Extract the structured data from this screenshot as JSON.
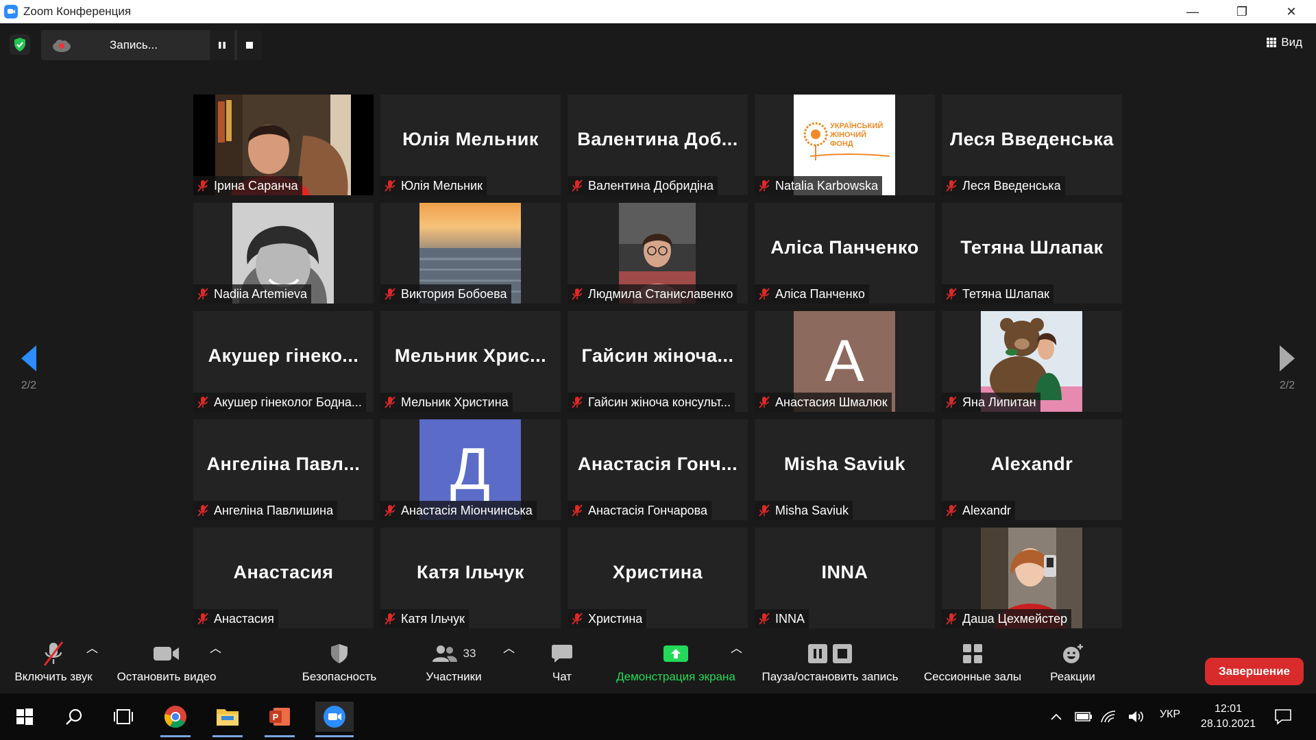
{
  "window": {
    "title": "Zoom Конференция",
    "minimize": "—",
    "restore": "❐",
    "close": "✕"
  },
  "recording": {
    "label": "Запись..."
  },
  "view": {
    "label": "Вид"
  },
  "nav": {
    "left_page": "2/2",
    "right_page": "2/2"
  },
  "participants": [
    {
      "name": "Ірина Саранча",
      "display": "",
      "tile": "photo-woman-red"
    },
    {
      "name": "Юлія Мельник",
      "display": "Юлія Мельник",
      "tile": "name"
    },
    {
      "name": "Валентина Добридіна",
      "display": "Валентина Доб...",
      "tile": "name"
    },
    {
      "name": "Natalia Karbowska",
      "display": "",
      "tile": "logo",
      "logo_text": "УКРАЇНСЬКИЙ ЖІНОЧИЙ ФОНД"
    },
    {
      "name": "Леся Введенська",
      "display": "Леся Введенська",
      "tile": "name"
    },
    {
      "name": "Nadiia Artemieva",
      "display": "",
      "tile": "photo-bw"
    },
    {
      "name": "Виктория Бобоева",
      "display": "",
      "tile": "photo-sunset"
    },
    {
      "name": "Людмила Станиславенко",
      "display": "",
      "tile": "photo-car"
    },
    {
      "name": "Аліса Панченко",
      "display": "Аліса Панченко",
      "tile": "name"
    },
    {
      "name": "Тетяна Шлапак",
      "display": "Тетяна Шлапак",
      "tile": "name"
    },
    {
      "name": "Акушер гінеколог Бодна...",
      "display": "Акушер гінеко...",
      "tile": "name"
    },
    {
      "name": "Мельник Христина",
      "display": "Мельник Хрис...",
      "tile": "name"
    },
    {
      "name": "Гайсин жіноча консульт...",
      "display": "Гайсин жіноча...",
      "tile": "name"
    },
    {
      "name": "Анастасия Шмалюк",
      "display": "",
      "tile": "avatar",
      "avatar_letter": "A",
      "avatar_color": "#8c6a5d"
    },
    {
      "name": "Яна Липитан",
      "display": "",
      "tile": "photo-bear"
    },
    {
      "name": "Ангеліна Павлишина",
      "display": "Ангеліна Павл...",
      "tile": "name"
    },
    {
      "name": "Анастасія Міончинська",
      "display": "",
      "tile": "avatar",
      "avatar_letter": "Д",
      "avatar_color": "#5b6bc8"
    },
    {
      "name": "Анастасія Гончарова",
      "display": "Анастасія Гонч...",
      "tile": "name"
    },
    {
      "name": "Misha Saviuk",
      "display": "Misha Saviuk",
      "tile": "name"
    },
    {
      "name": "Alexandr",
      "display": "Alexandr",
      "tile": "name"
    },
    {
      "name": "Анастасия",
      "display": "Анастасия",
      "tile": "name"
    },
    {
      "name": "Катя Ільчук",
      "display": "Катя Ільчук",
      "tile": "name"
    },
    {
      "name": "Христина",
      "display": "Христина",
      "tile": "name"
    },
    {
      "name": "INNA",
      "display": "INNA",
      "tile": "name"
    },
    {
      "name": "Даша Цехмейстер",
      "display": "",
      "tile": "photo-selfie"
    }
  ],
  "toolbar": {
    "unmute": "Включить звук",
    "stop_video": "Остановить видео",
    "security": "Безопасность",
    "participants": "Участники",
    "participants_count": "33",
    "chat": "Чат",
    "share_screen": "Демонстрация экрана",
    "pause_stop_rec": "Пауза/остановить запись",
    "breakout": "Сессионные залы",
    "reactions": "Реакции",
    "end": "Завершение"
  },
  "taskbar": {
    "language": "УКР",
    "time": "12:01",
    "date": "28.10.2021"
  },
  "colors": {
    "accent": "#2D8CFF",
    "share_green": "#23d959",
    "end_red": "#d92b2b",
    "mute_red": "#e02828"
  }
}
